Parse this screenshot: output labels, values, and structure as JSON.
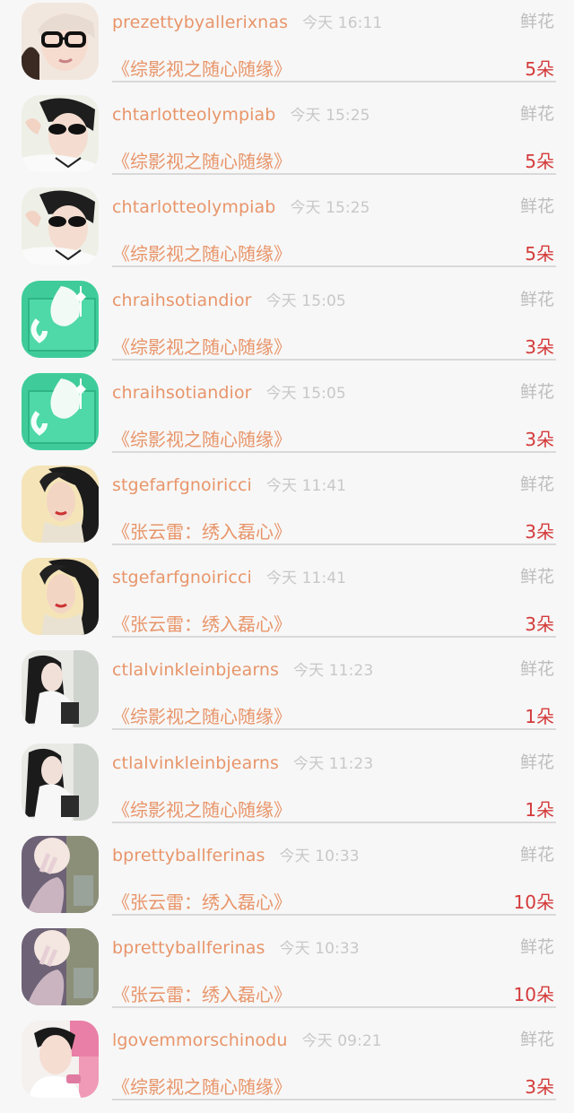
{
  "rows": [
    {
      "user": "prezettybyallerixnas",
      "time": "今天 16:11",
      "gift_type": "鲜花",
      "book": "《综影视之随心随缘》",
      "count": "5朵",
      "avatar_icon": "glasses-girl-avatar"
    },
    {
      "user": "chtarlotteolympiab",
      "time": "今天 15:25",
      "gift_type": "鲜花",
      "book": "《综影视之随心随缘》",
      "count": "5朵",
      "avatar_icon": "sunglasses-boy-avatar"
    },
    {
      "user": "chtarlotteolympiab",
      "time": "今天 15:25",
      "gift_type": "鲜花",
      "book": "《综影视之随心随缘》",
      "count": "5朵",
      "avatar_icon": "sunglasses-boy-avatar"
    },
    {
      "user": "chraihsotiandior",
      "time": "今天 15:05",
      "gift_type": "鲜花",
      "book": "《综影视之随心随缘》",
      "count": "3朵",
      "avatar_icon": "teal-cup-avatar"
    },
    {
      "user": "chraihsotiandior",
      "time": "今天 15:05",
      "gift_type": "鲜花",
      "book": "《综影视之随心随缘》",
      "count": "3朵",
      "avatar_icon": "teal-cup-avatar"
    },
    {
      "user": "stgefarfgnoiricci",
      "time": "今天 11:41",
      "gift_type": "鲜花",
      "book": "《张云雷：绣入磊心》",
      "count": "3朵",
      "avatar_icon": "retro-woman-avatar"
    },
    {
      "user": "stgefarfgnoiricci",
      "time": "今天 11:41",
      "gift_type": "鲜花",
      "book": "《张云雷：绣入磊心》",
      "count": "3朵",
      "avatar_icon": "retro-woman-avatar"
    },
    {
      "user": "ctlalvinkleinbjearns",
      "time": "今天 11:23",
      "gift_type": "鲜花",
      "book": "《综影视之随心随缘》",
      "count": "1朵",
      "avatar_icon": "longhair-girl-avatar"
    },
    {
      "user": "ctlalvinkleinbjearns",
      "time": "今天 11:23",
      "gift_type": "鲜花",
      "book": "《综影视之随心随缘》",
      "count": "1朵",
      "avatar_icon": "longhair-girl-avatar"
    },
    {
      "user": "bprettyballferinas",
      "time": "今天 10:33",
      "gift_type": "鲜花",
      "book": "《张云雷：绣入磊心》",
      "count": "10朵",
      "avatar_icon": "hand-light-avatar"
    },
    {
      "user": "bprettyballferinas",
      "time": "今天 10:33",
      "gift_type": "鲜花",
      "book": "《张云雷：绣入磊心》",
      "count": "10朵",
      "avatar_icon": "hand-light-avatar"
    },
    {
      "user": "lgovemmorschinodu",
      "time": "今天 09:21",
      "gift_type": "鲜花",
      "book": "《综影视之随心随缘》",
      "count": "3朵",
      "avatar_icon": "pink-boy-avatar"
    }
  ]
}
